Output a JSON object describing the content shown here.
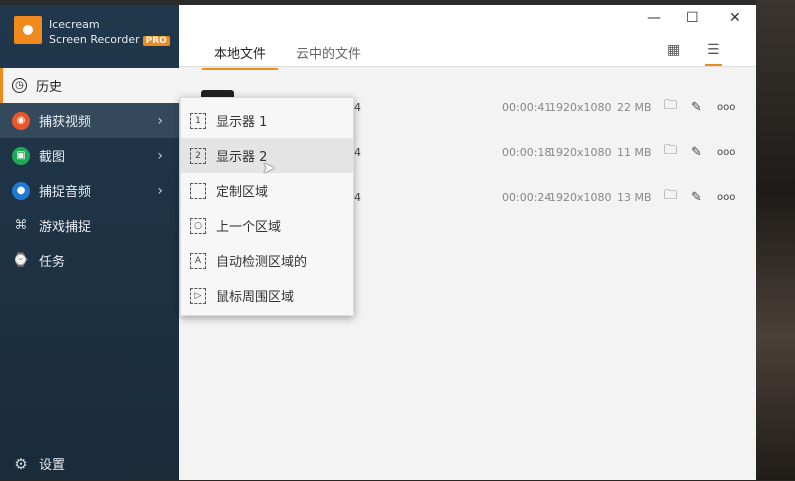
{
  "app": {
    "name_line1": "Icecream",
    "name_line2": "Screen Recorder",
    "badge": "PRO",
    "accent": "#f08a1c"
  },
  "sidebar": {
    "items": [
      {
        "label": "历史",
        "icon": "clock-icon"
      },
      {
        "label": "捕获视频",
        "icon": "record-icon",
        "color": "#e8572a"
      },
      {
        "label": "截图",
        "icon": "camera-icon",
        "color": "#1fa855"
      },
      {
        "label": "捕捉音频",
        "icon": "microphone-icon",
        "color": "#1f78d1"
      },
      {
        "label": "游戏捕捉",
        "icon": "gamepad-icon"
      },
      {
        "label": "任务",
        "icon": "task-clock-icon"
      }
    ],
    "settings": "设置"
  },
  "tabs": [
    {
      "label": "本地文件"
    },
    {
      "label": "云中的文件"
    }
  ],
  "files": [
    {
      "name_tail": "4",
      "duration": "00:00:41",
      "resolution": "1920x1080",
      "size": "22 MB"
    },
    {
      "name_tail": "4",
      "duration": "00:00:18",
      "resolution": "1920x1080",
      "size": "11 MB"
    },
    {
      "name_tail": "4",
      "duration": "00:00:24",
      "resolution": "1920x1080",
      "size": "13 MB"
    }
  ],
  "submenu": [
    {
      "label": "显示器 1",
      "glyph": "1"
    },
    {
      "label": "显示器 2",
      "glyph": "2"
    },
    {
      "label": "定制区域",
      "glyph": ""
    },
    {
      "label": "上一个区域",
      "glyph": "○"
    },
    {
      "label": "自动检测区域的",
      "glyph": "A"
    },
    {
      "label": "鼠标周围区域",
      "glyph": "▷"
    }
  ],
  "window": {
    "minimize": "—",
    "maximize": "☐",
    "close": "✕"
  }
}
